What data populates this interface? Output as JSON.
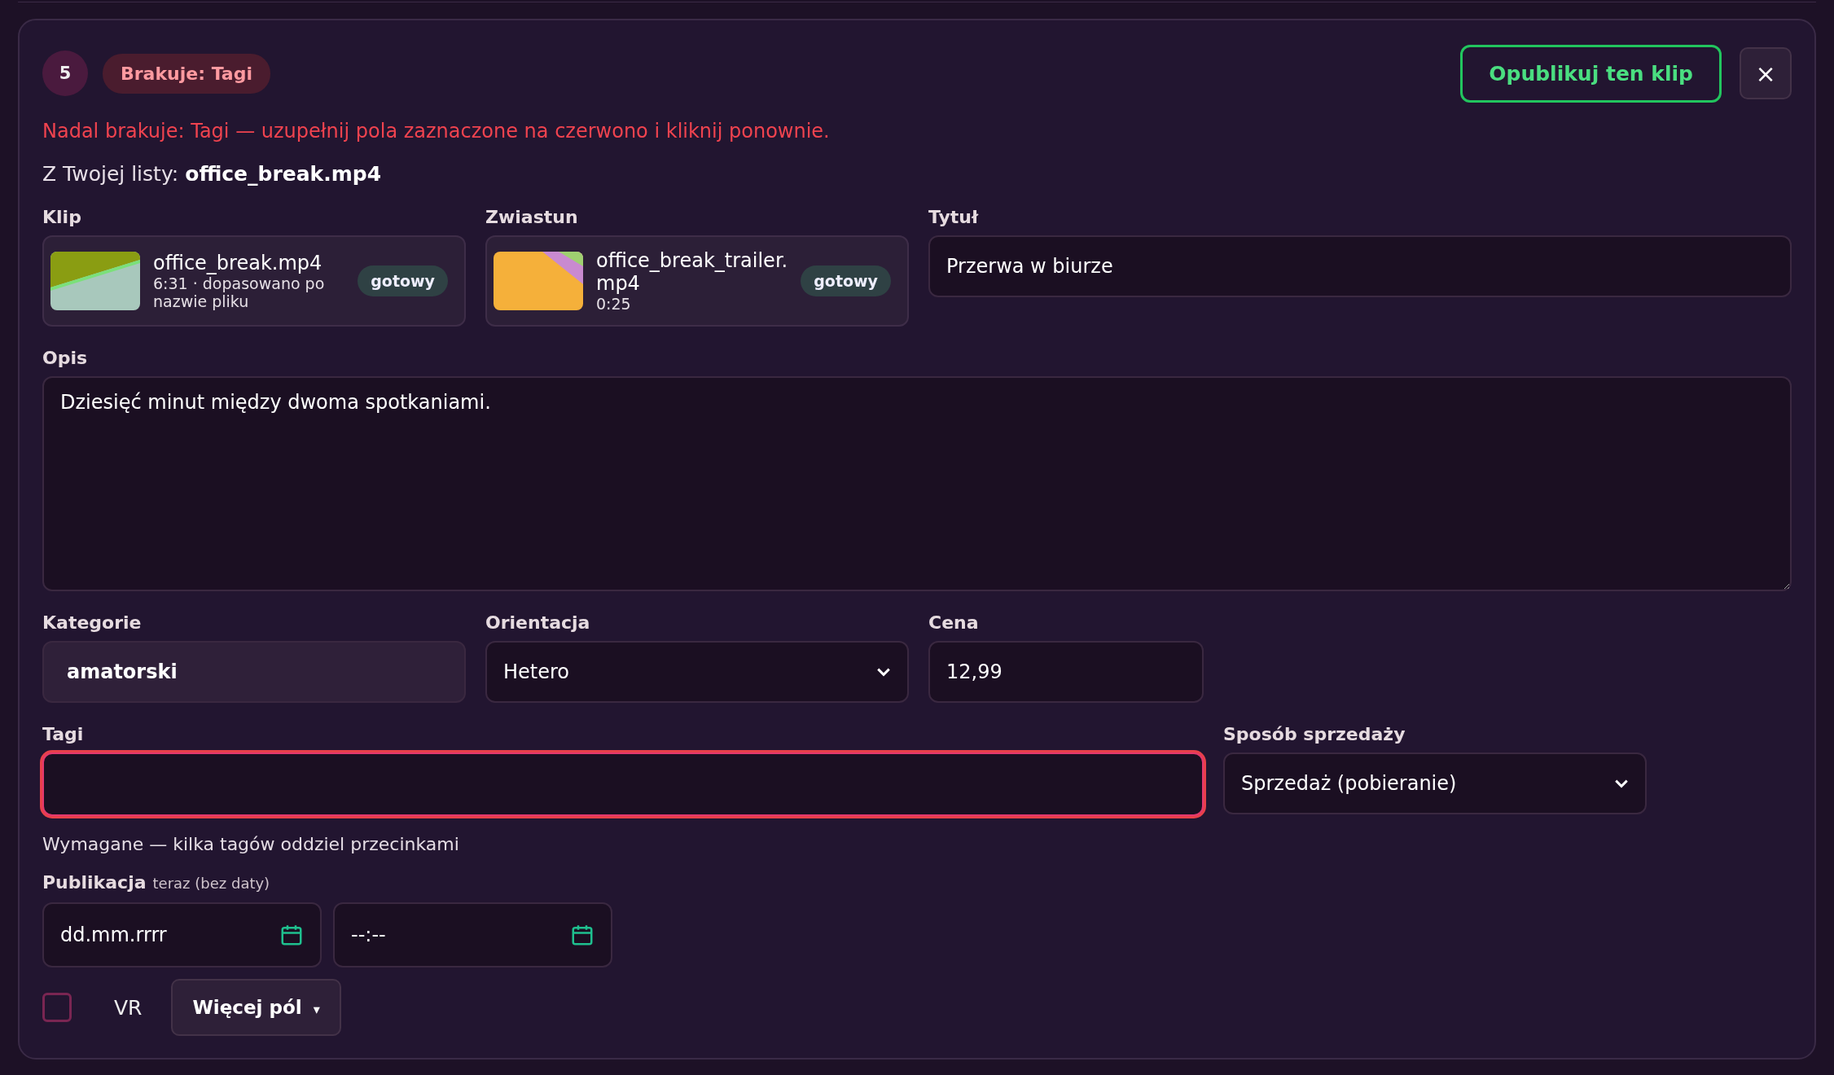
{
  "step": "5",
  "missing_badge": "Brakuje: Tagi",
  "publish_button": "Opublikuj ten klip",
  "close_button": "×",
  "error": "Nadal brakuje: Tagi — uzupełnij pola zaznaczone na czerwono i kliknij ponownie.",
  "source": "Z Twojej listy: **office_break.mp4**",
  "clip": {
    "label": "Klip",
    "filename": "office_break.mp4",
    "meta": "6:31 · dopasowano po nazwie pliku",
    "status": "gotowy"
  },
  "trailer": {
    "label": "Zwiastun",
    "filename": "office_break_trailer.mp4",
    "meta": "0:25",
    "status": "gotowy"
  },
  "title": {
    "label": "Tytuł",
    "value": "Przerwa w biurze"
  },
  "description": {
    "label": "Opis",
    "value": "Dziesięć minut między dwoma spotkaniami."
  },
  "categories": {
    "label": "Kategorie",
    "value": "amatorski"
  },
  "orientation": {
    "label": "Orientacja",
    "value": "Hetero"
  },
  "price": {
    "label": "Cena",
    "value": "12,99"
  },
  "tags": {
    "label": "Tagi",
    "invalid": true,
    "hint": "Wymagane — kilka tagów oddziel przecinkami"
  },
  "sale_mode": {
    "label": "Sposób sprzedaży",
    "value": "Sprzedaż (pobieranie)"
  },
  "publication": {
    "label": "Publikacja",
    "note": "teraz (bez daty)",
    "date_placeholder": "dd.mm.rrrr",
    "time_placeholder": "--:--"
  },
  "vr": {
    "label": "VR",
    "checked": false
  },
  "more_button": {
    "label": "Więcej pól",
    "caret": "▾"
  }
}
